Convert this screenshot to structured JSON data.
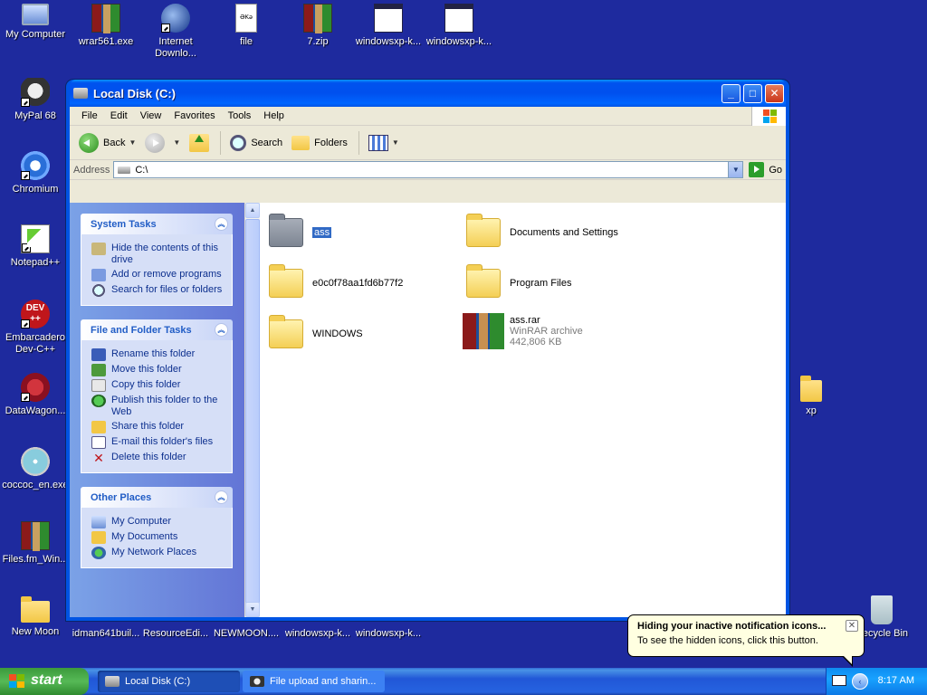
{
  "desktop": {
    "icons_top": [
      "My Computer",
      "wrar561.exe",
      "Internet Downlo...",
      "file",
      "7.zip",
      "windowsxp-k...",
      "windowsxp-k..."
    ],
    "icons_left": [
      "MyPal 68",
      "Chromium",
      "Notepad++",
      "Embarcadero Dev-C++",
      "DataWagon...",
      "coccoc_en.exe",
      "Files.fm_Win...",
      "New Moon"
    ],
    "icons_bottom": [
      "idman641buil...",
      "ResourceEdi...",
      "NEWMOON....",
      "windowsxp-k...",
      "windowsxp-k..."
    ],
    "icon_xp": "xp",
    "icon_recycle": "Recycle Bin",
    "dev_icon_text": "DEV\n++",
    "file_icon_text": "ƏKə"
  },
  "window": {
    "title": "Local Disk (C:)",
    "menu": [
      "File",
      "Edit",
      "View",
      "Favorites",
      "Tools",
      "Help"
    ],
    "toolbar": {
      "back": "Back",
      "search": "Search",
      "folders": "Folders"
    },
    "address": {
      "label": "Address",
      "value": "C:\\",
      "go": "Go"
    }
  },
  "taskpane": {
    "system_tasks": {
      "title": "System Tasks",
      "items": [
        "Hide the contents of this drive",
        "Add or remove programs",
        "Search for files or folders"
      ]
    },
    "file_folder_tasks": {
      "title": "File and Folder Tasks",
      "items": [
        "Rename this folder",
        "Move this folder",
        "Copy this folder",
        "Publish this folder to the Web",
        "Share this folder",
        "E-mail this folder's files",
        "Delete this folder"
      ]
    },
    "other_places": {
      "title": "Other Places",
      "items": [
        "My Computer",
        "My Documents",
        "My Network Places"
      ]
    }
  },
  "files": [
    {
      "name": "ass",
      "type": "folder",
      "selected": true
    },
    {
      "name": "Documents and Settings",
      "type": "folder"
    },
    {
      "name": "e0c0f78aa1fd6b77f2",
      "type": "folder"
    },
    {
      "name": "Program Files",
      "type": "folder"
    },
    {
      "name": "WINDOWS",
      "type": "folder"
    },
    {
      "name": "ass.rar",
      "type": "rar",
      "desc": "WinRAR archive",
      "size": "442,806 KB"
    }
  ],
  "taskbar": {
    "start": "start",
    "tasks": [
      "Local Disk (C:)",
      "File upload and sharin..."
    ],
    "clock": "8:17 AM"
  },
  "balloon": {
    "title": "Hiding your inactive notification icons...",
    "body": "To see the hidden icons, click this button."
  }
}
